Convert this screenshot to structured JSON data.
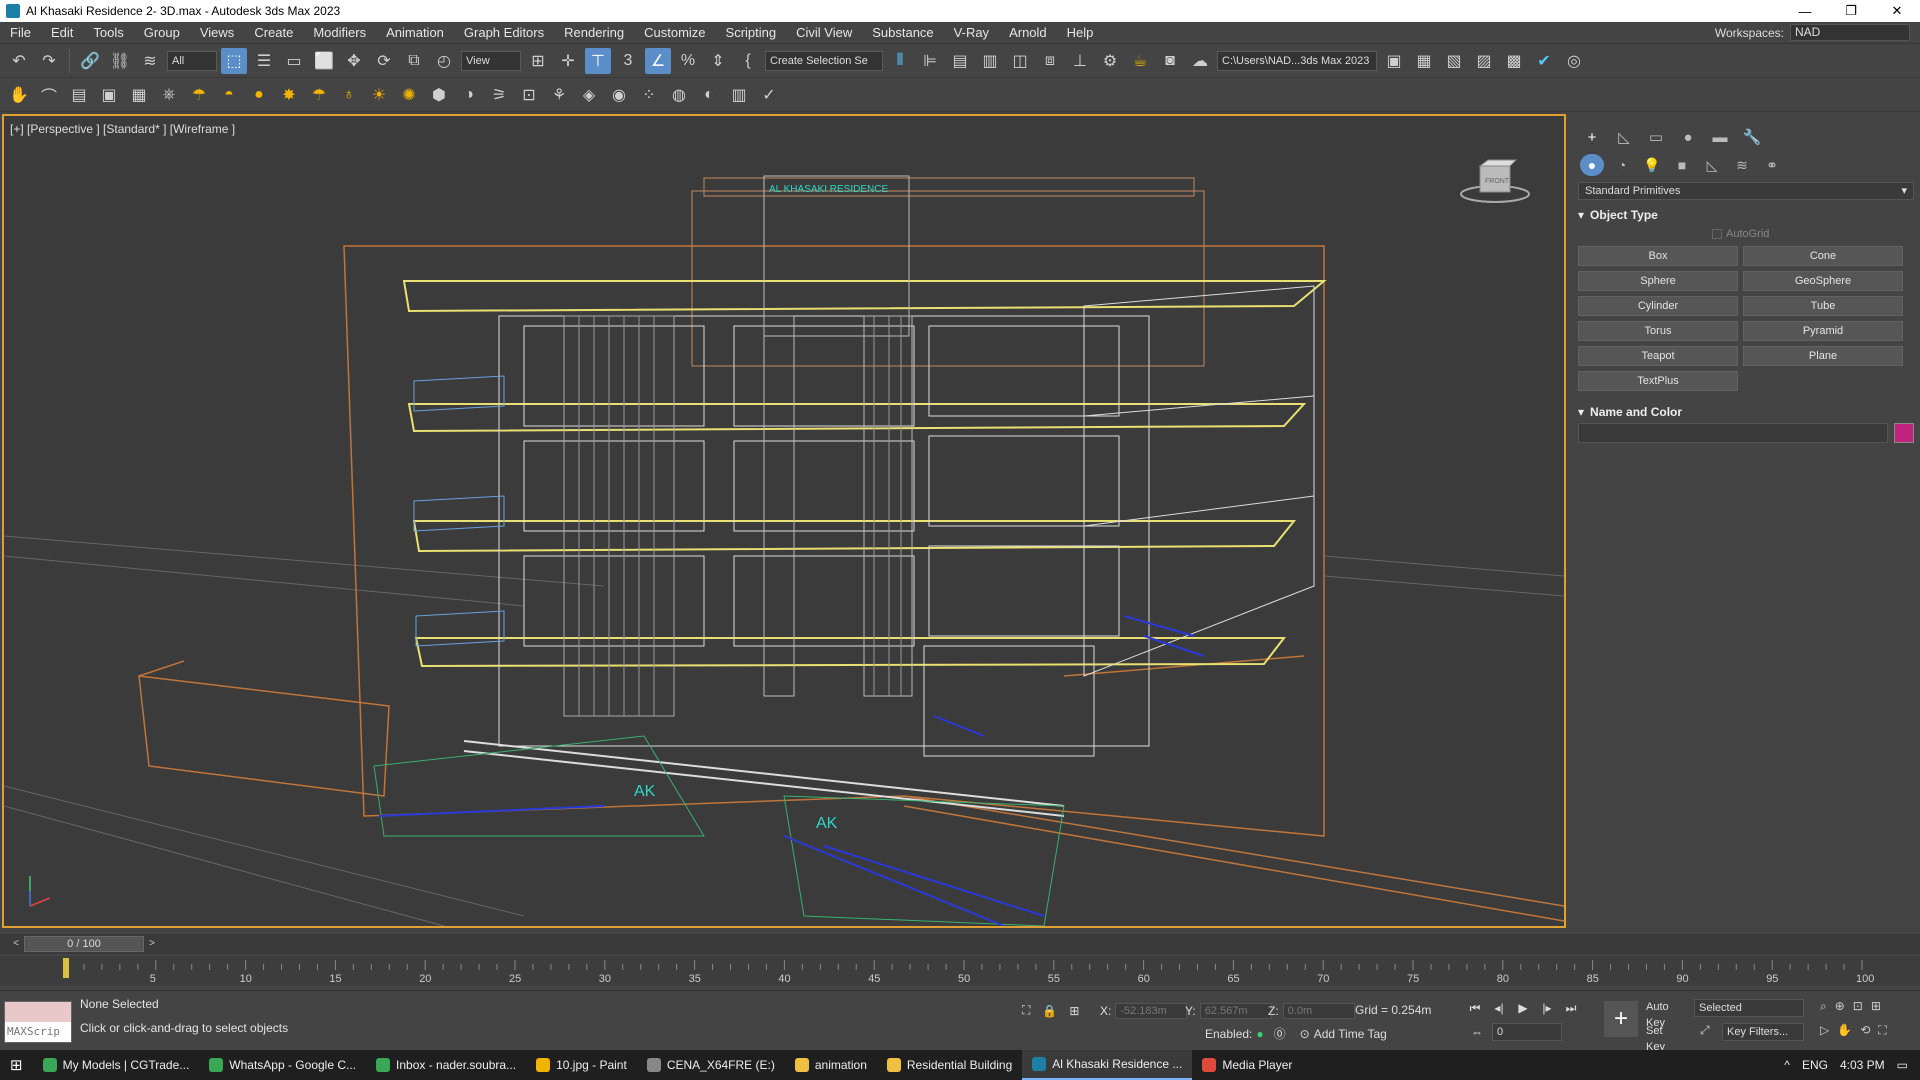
{
  "window": {
    "title": "Al Khasaki Residence 2- 3D.max - Autodesk 3ds Max 2023",
    "minimize": "—",
    "restore": "❐",
    "close": "✕"
  },
  "menu": {
    "items": [
      "File",
      "Edit",
      "Tools",
      "Group",
      "Views",
      "Create",
      "Modifiers",
      "Animation",
      "Graph Editors",
      "Rendering",
      "Customize",
      "Scripting",
      "Civil View",
      "Substance",
      "V-Ray",
      "Arnold",
      "Help"
    ],
    "workspaces_label": "Workspaces:",
    "workspaces_value": "NAD"
  },
  "toolbar": {
    "filter_value": "All",
    "view_value": "View",
    "selection_set": "Create Selection Se",
    "project_path": "C:\\Users\\NAD...3ds Max 2023"
  },
  "viewport": {
    "label": "[+] [Perspective ] [Standard* ] [Wireframe ]",
    "sign_text": "AL KHASAKI RESIDENCE",
    "logo1": "AK",
    "logo2": "AK",
    "viewcube_label": "FRONT"
  },
  "command_panel": {
    "category": "Standard Primitives",
    "object_type_title": "Object Type",
    "autogrid_label": "AutoGrid",
    "buttons": [
      "Box",
      "Cone",
      "Sphere",
      "GeoSphere",
      "Cylinder",
      "Tube",
      "Torus",
      "Pyramid",
      "Teapot",
      "Plane",
      "TextPlus"
    ],
    "name_color_title": "Name and Color",
    "color": "#c2237d"
  },
  "timeline": {
    "frame_display": "0 / 100",
    "ticks": [
      5,
      10,
      15,
      20,
      25,
      30,
      35,
      40,
      45,
      50,
      55,
      60,
      65,
      70,
      75,
      80,
      85,
      90,
      95,
      100
    ]
  },
  "status": {
    "maxscript_label": "MAXScrip",
    "selection": "None Selected",
    "prompt": "Click or click-and-drag to select objects",
    "x_label": "X:",
    "x_value": "-52.183m",
    "y_label": "Y:",
    "y_value": "62.567m",
    "z_label": "Z:",
    "z_value": "0.0m",
    "grid": "Grid = 0.254m",
    "enabled_label": "Enabled:",
    "add_time_tag": "Add Time Tag",
    "auto_key": "Auto Key",
    "set_key": "Set Key",
    "selected_value": "Selected",
    "key_filters": "Key Filters...",
    "frame_value": "0"
  },
  "taskbar": {
    "items": [
      {
        "label": "My Models | CGTrade...",
        "color": "#3aa757"
      },
      {
        "label": "WhatsApp - Google C...",
        "color": "#3aa757"
      },
      {
        "label": "Inbox - nader.soubra...",
        "color": "#3aa757"
      },
      {
        "label": "10.jpg - Paint",
        "color": "#f0b400"
      },
      {
        "label": "CENA_X64FRE (E:)",
        "color": "#888888"
      },
      {
        "label": "animation",
        "color": "#f0c040"
      },
      {
        "label": "Residential Building",
        "color": "#f0c040"
      },
      {
        "label": "Al Khasaki Residence ...",
        "color": "#1b7fa6"
      },
      {
        "label": "Media Player",
        "color": "#e04a3a"
      }
    ],
    "lang": "ENG",
    "time": "4:03 PM"
  }
}
